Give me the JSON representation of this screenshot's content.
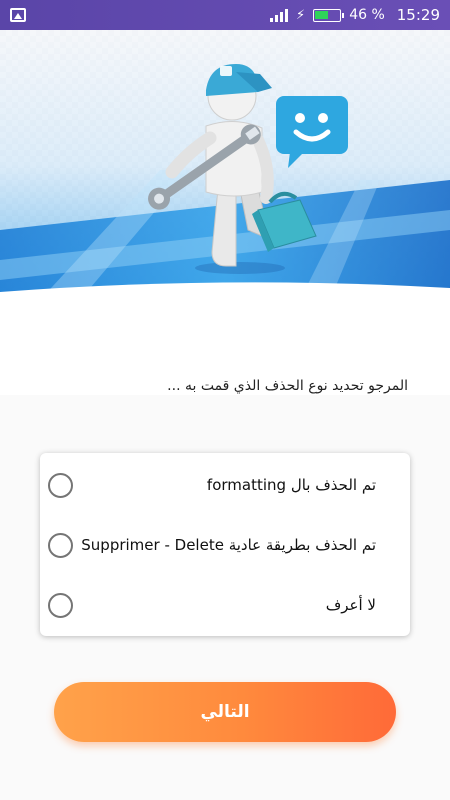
{
  "status_bar": {
    "battery": "46 %",
    "time": "15:29",
    "colors": {
      "background": "#5a45a8",
      "battery_fill": "#2fd35a"
    }
  },
  "hero": {
    "icons": [
      "repairman-figure",
      "wrench-icon",
      "toolbox-icon",
      "smiley-chat-bubble-icon"
    ],
    "colors": {
      "bubble": "#2ea7e0",
      "toolbox": "#3fb6c8",
      "cap": "#3aa9d6"
    }
  },
  "prompt": "المرجو تحديد نوع الحذف الذي قمت به ...",
  "options": [
    {
      "label": "تم الحذف بال formatting",
      "selected": false
    },
    {
      "label": "تم الحذف بطريقة عادية Supprimer - Delete",
      "selected": false
    },
    {
      "label": "لا أعرف",
      "selected": false
    }
  ],
  "next_button": {
    "label": "التالي",
    "colors": {
      "start": "#ffa24a",
      "end": "#ff6a38"
    }
  }
}
